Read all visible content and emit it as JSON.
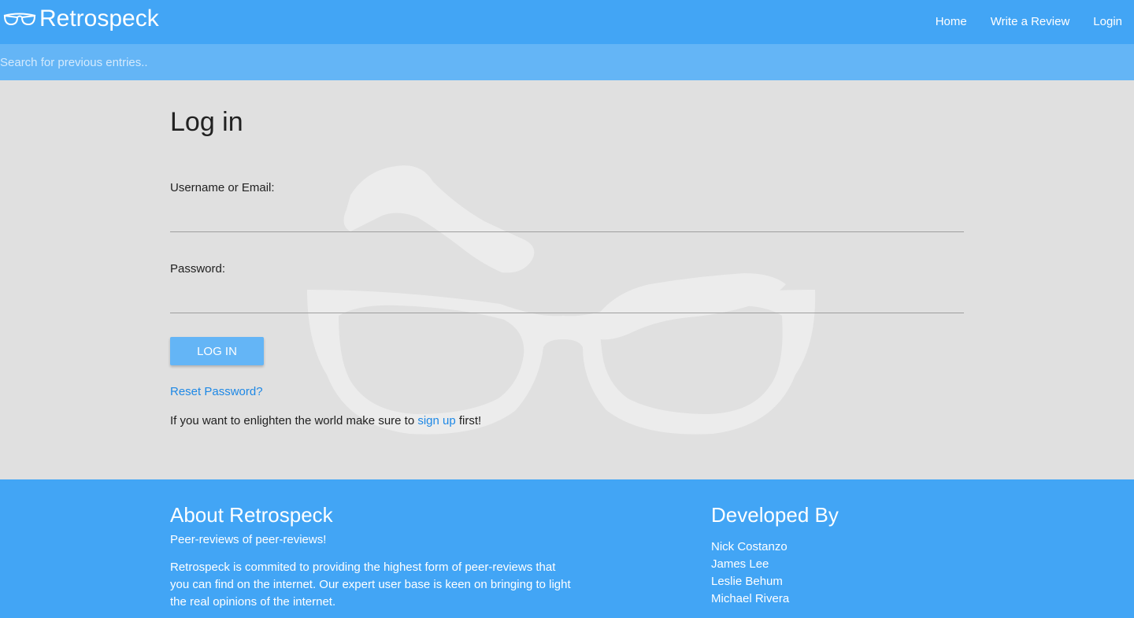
{
  "header": {
    "brand": "Retrospeck",
    "nav": [
      "Home",
      "Write a Review",
      "Login"
    ]
  },
  "search": {
    "placeholder": "Search for previous entries.."
  },
  "login": {
    "title": "Log in",
    "username_label": "Username or Email:",
    "username_value": "",
    "password_label": "Password:",
    "password_value": "",
    "button": "LOG IN",
    "reset_link": "Reset Password?",
    "signup_prefix": "If you want to enlighten the world make sure to ",
    "signup_link": "sign up",
    "signup_suffix": " first!"
  },
  "footer": {
    "about_title": "About Retrospeck",
    "about_tagline": "Peer-reviews of peer-reviews!",
    "about_body": "Retrospeck is commited to providing the highest form of peer-reviews that you can find on the internet. Our expert user base is keen on bringing to light the real opinions of the internet.",
    "developers_title": "Developed By",
    "developers": [
      "Nick Costanzo",
      "James Lee",
      "Leslie Behum",
      "Michael Rivera"
    ]
  },
  "colors": {
    "primary": "#42a5f5",
    "search_bar": "#64b5f6",
    "button": "#64b5f6",
    "link": "#1e88e5",
    "background": "#e0e0e0"
  },
  "icons": {
    "brand": "glasses-icon",
    "watermark": "glasses-eyebrows-watermark"
  }
}
